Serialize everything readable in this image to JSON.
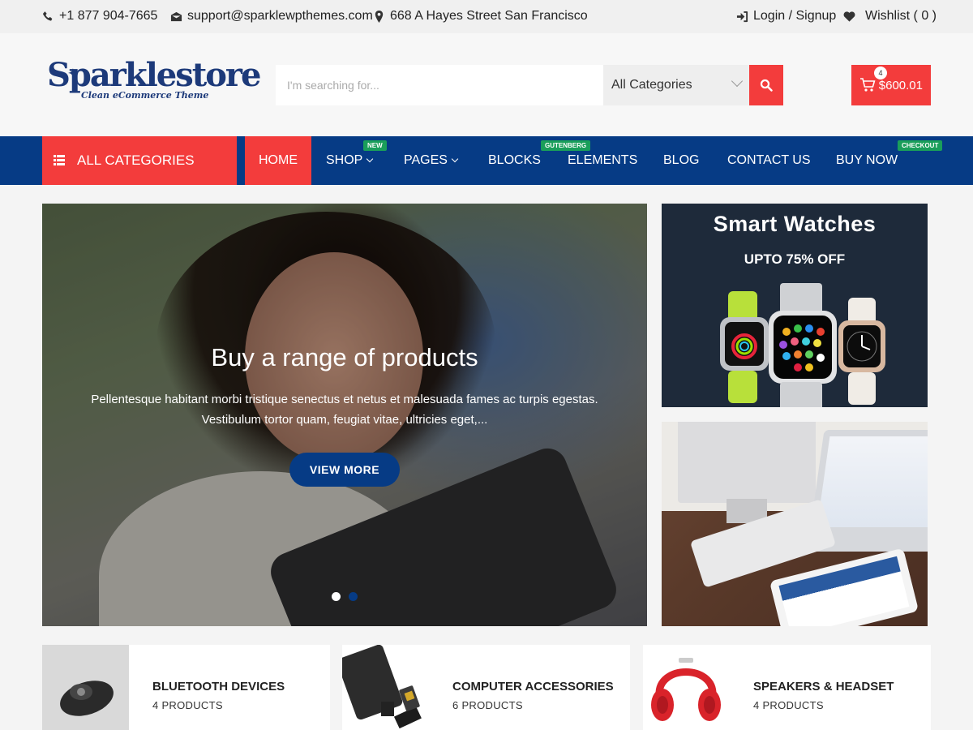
{
  "topbar": {
    "phone": "+1 877 904-7665",
    "email": "support@sparklewpthemes.com",
    "address": "668 A Hayes Street San Francisco",
    "login": "Login / Signup",
    "wishlist": "Wishlist ( 0 )"
  },
  "header": {
    "logo_main": "Sparklestore",
    "logo_sub": "Clean eCommerce Theme",
    "search_placeholder": "I'm searching for...",
    "category_selected": "All Categories",
    "cart_count": "4",
    "cart_total": "$600.01"
  },
  "nav": {
    "all_categories": "ALL CATEGORIES",
    "items": [
      {
        "label": "HOME",
        "badge": ""
      },
      {
        "label": "SHOP",
        "badge": "NEW"
      },
      {
        "label": "PAGES",
        "badge": ""
      },
      {
        "label": "BLOCKS",
        "badge": "GUTENBERG"
      },
      {
        "label": "ELEMENTS",
        "badge": ""
      },
      {
        "label": "BLOG",
        "badge": ""
      },
      {
        "label": "CONTACT US",
        "badge": ""
      },
      {
        "label": "BUY NOW",
        "badge": "CHECKOUT"
      }
    ]
  },
  "slider": {
    "title": "Buy a range of products",
    "text": "Pellentesque habitant morbi tristique senectus et netus et malesuada fames ac turpis egestas. Vestibulum tortor quam, feugiat vitae, ultricies eget,...",
    "button": "VIEW MORE",
    "active_slide": 2,
    "slide_count": 2
  },
  "banners": {
    "watch_title": "Smart Watches",
    "watch_subtitle": "UPTO 75% OFF"
  },
  "categories": [
    {
      "title": "BLUETOOTH DEVICES",
      "count": "4 PRODUCTS"
    },
    {
      "title": "COMPUTER ACCESSORIES",
      "count": "6 PRODUCTS"
    },
    {
      "title": "SPEAKERS & HEADSET",
      "count": "4 PRODUCTS"
    }
  ],
  "colors": {
    "accent_red": "#f33c3c",
    "nav_blue": "#063b85",
    "badge_green": "#1a9e5a"
  }
}
